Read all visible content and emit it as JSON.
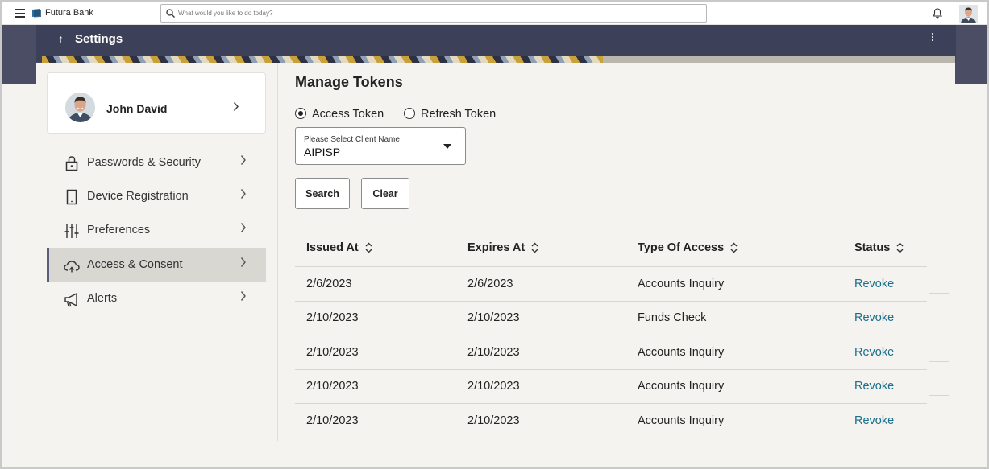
{
  "app": {
    "brand": "Futura Bank",
    "search_placeholder": "What would you like to do today?"
  },
  "header": {
    "back_arrow": "↑",
    "title": "Settings"
  },
  "profile": {
    "name": "John David"
  },
  "sidebar": {
    "items": [
      {
        "label": "Passwords & Security",
        "icon": "lock-icon"
      },
      {
        "label": "Device Registration",
        "icon": "device-icon"
      },
      {
        "label": "Preferences",
        "icon": "sliders-icon"
      },
      {
        "label": "Access & Consent",
        "icon": "cloud-access-icon",
        "active": true
      },
      {
        "label": "Alerts",
        "icon": "megaphone-icon"
      }
    ]
  },
  "main": {
    "title": "Manage Tokens",
    "radios": [
      {
        "label": "Access Token",
        "checked": true
      },
      {
        "label": "Refresh Token",
        "checked": false
      }
    ],
    "client_select": {
      "label": "Please Select Client Name",
      "value": "AIPISP"
    },
    "buttons": {
      "search": "Search",
      "clear": "Clear"
    },
    "table": {
      "columns": [
        "Issued At",
        "Expires At",
        "Type Of Access",
        "Status"
      ],
      "rows": [
        {
          "issued": "2/6/2023",
          "expires": "2/6/2023",
          "type": "Accounts Inquiry",
          "status": "Revoke"
        },
        {
          "issued": "2/10/2023",
          "expires": "2/10/2023",
          "type": "Funds Check",
          "status": "Revoke"
        },
        {
          "issued": "2/10/2023",
          "expires": "2/10/2023",
          "type": "Accounts Inquiry",
          "status": "Revoke"
        },
        {
          "issued": "2/10/2023",
          "expires": "2/10/2023",
          "type": "Accounts Inquiry",
          "status": "Revoke"
        },
        {
          "issued": "2/10/2023",
          "expires": "2/10/2023",
          "type": "Accounts Inquiry",
          "status": "Revoke"
        }
      ]
    }
  },
  "colors": {
    "header_band": "#4a4d64",
    "link": "#1a6f8a",
    "active_nav": "#d9d7d2"
  }
}
